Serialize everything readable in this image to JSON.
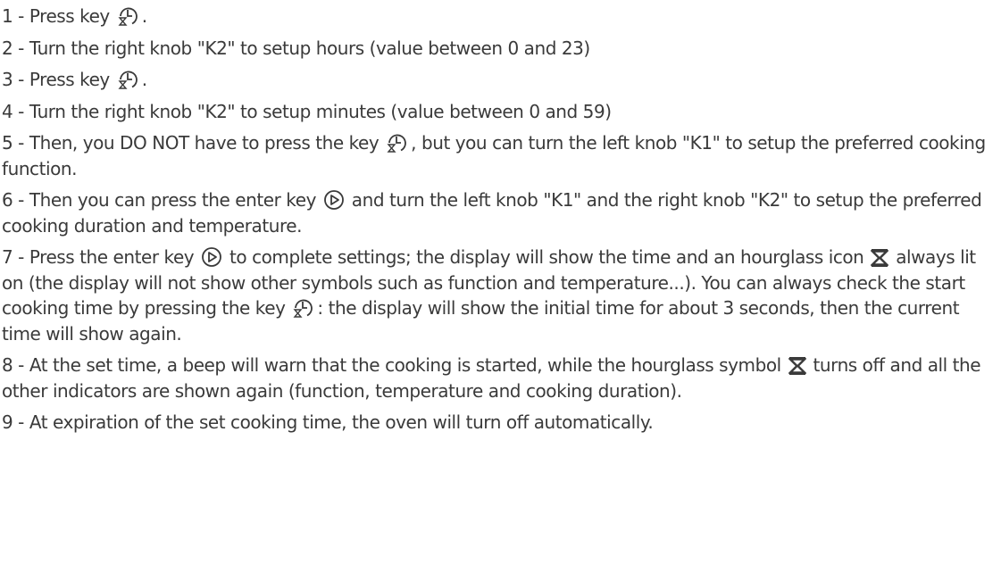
{
  "icons": {
    "clock_key": "timer-clock-key-icon",
    "enter_key": "enter-play-key-icon",
    "hourglass": "hourglass-icon"
  },
  "steps": [
    {
      "a": "1 - Press key ",
      "b": "."
    },
    {
      "a": "2 - Turn the right knob \"K2\" to setup hours (value between 0 and 23)"
    },
    {
      "a": "3 - Press key ",
      "b": "."
    },
    {
      "a": "4 - Turn the right knob \"K2\" to setup minutes (value between 0 and 59)"
    },
    {
      "a": "5 - Then, you DO NOT have to press the key ",
      "b": ", but you can turn the left knob \"K1\" to setup the preferred cooking function."
    },
    {
      "a": "6 - Then you can press the enter key ",
      "b": " and turn the left knob \"K1\" and the right knob \"K2\" to setup the preferred cooking duration and temperature."
    },
    {
      "a": "7 - Press the enter key ",
      "b": " to complete settings; the display will show the time and an hourglass icon ",
      "c": " always lit on (the display will not show other symbols such as function and temperature...). You can always check the start cooking time by pressing the key ",
      "d": ": the display will show the initial time for about 3 seconds, then the current time will show again."
    },
    {
      "a": "8 - At the set time, a beep will warn that the cooking is started, while the hourglass symbol ",
      "b": " turns off and all the other indicators are shown again (function, temperature and cooking duration)."
    },
    {
      "a": "9 - At expiration of the set cooking time, the oven will turn off automatically."
    }
  ]
}
